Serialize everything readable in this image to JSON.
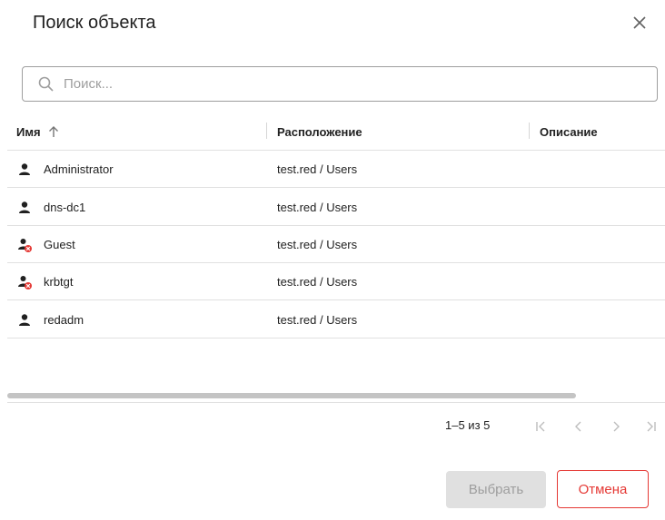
{
  "dialog": {
    "title": "Поиск объекта",
    "close_icon": "close-icon"
  },
  "search": {
    "placeholder": "Поиск...",
    "value": "",
    "icon": "search-icon"
  },
  "table": {
    "columns": [
      {
        "label": "Имя",
        "sort": "ascending"
      },
      {
        "label": "Расположение"
      },
      {
        "label": "Описание"
      }
    ],
    "rows": [
      {
        "name": "Administrator",
        "location": "test.red / Users",
        "description": "",
        "icon": "user-icon",
        "disabled": false
      },
      {
        "name": "dns-dc1",
        "location": "test.red / Users",
        "description": "",
        "icon": "user-icon",
        "disabled": false
      },
      {
        "name": "Guest",
        "location": "test.red / Users",
        "description": "",
        "icon": "user-disabled-icon",
        "disabled": true
      },
      {
        "name": "krbtgt",
        "location": "test.red / Users",
        "description": "",
        "icon": "user-disabled-icon",
        "disabled": true
      },
      {
        "name": "redadm",
        "location": "test.red / Users",
        "description": "",
        "icon": "user-icon",
        "disabled": false
      }
    ]
  },
  "pagination": {
    "range_text": "1–5 из 5"
  },
  "actions": {
    "select_label": "Выбрать",
    "cancel_label": "Отмена"
  },
  "colors": {
    "text": "#212121",
    "muted": "#9e9e9e",
    "danger": "#e53935",
    "border": "#e0e0e0",
    "disabled_bg": "#e0e0e0"
  }
}
